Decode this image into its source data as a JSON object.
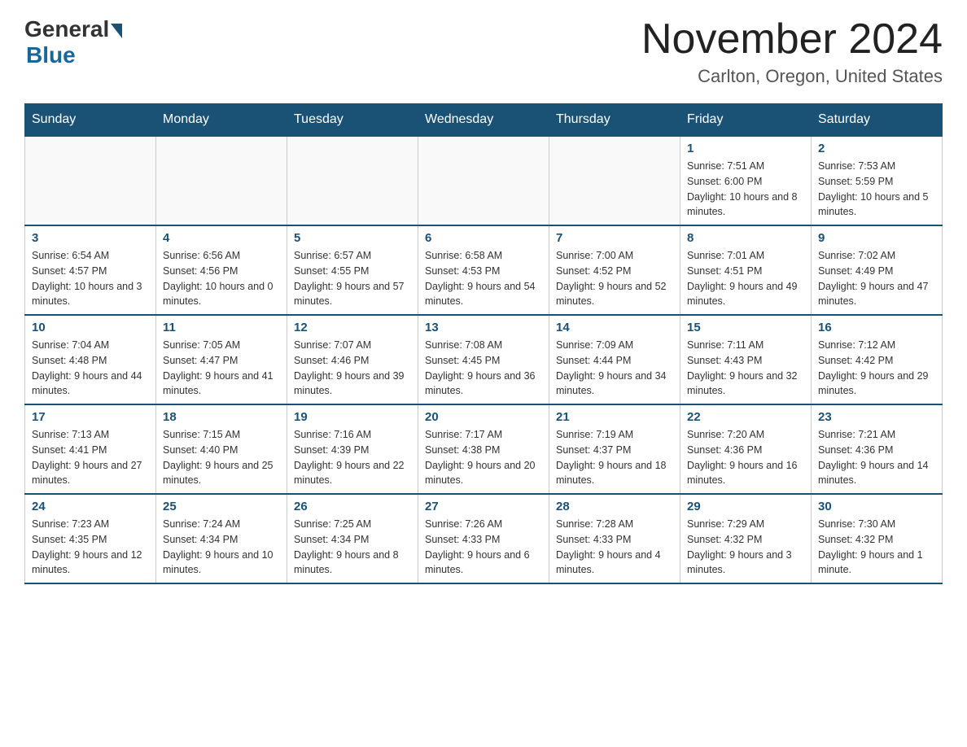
{
  "header": {
    "logo_general": "General",
    "logo_blue": "Blue",
    "month_title": "November 2024",
    "location": "Carlton, Oregon, United States"
  },
  "days_of_week": [
    "Sunday",
    "Monday",
    "Tuesday",
    "Wednesday",
    "Thursday",
    "Friday",
    "Saturday"
  ],
  "weeks": [
    [
      {
        "day": "",
        "info": ""
      },
      {
        "day": "",
        "info": ""
      },
      {
        "day": "",
        "info": ""
      },
      {
        "day": "",
        "info": ""
      },
      {
        "day": "",
        "info": ""
      },
      {
        "day": "1",
        "info": "Sunrise: 7:51 AM\nSunset: 6:00 PM\nDaylight: 10 hours and 8 minutes."
      },
      {
        "day": "2",
        "info": "Sunrise: 7:53 AM\nSunset: 5:59 PM\nDaylight: 10 hours and 5 minutes."
      }
    ],
    [
      {
        "day": "3",
        "info": "Sunrise: 6:54 AM\nSunset: 4:57 PM\nDaylight: 10 hours and 3 minutes."
      },
      {
        "day": "4",
        "info": "Sunrise: 6:56 AM\nSunset: 4:56 PM\nDaylight: 10 hours and 0 minutes."
      },
      {
        "day": "5",
        "info": "Sunrise: 6:57 AM\nSunset: 4:55 PM\nDaylight: 9 hours and 57 minutes."
      },
      {
        "day": "6",
        "info": "Sunrise: 6:58 AM\nSunset: 4:53 PM\nDaylight: 9 hours and 54 minutes."
      },
      {
        "day": "7",
        "info": "Sunrise: 7:00 AM\nSunset: 4:52 PM\nDaylight: 9 hours and 52 minutes."
      },
      {
        "day": "8",
        "info": "Sunrise: 7:01 AM\nSunset: 4:51 PM\nDaylight: 9 hours and 49 minutes."
      },
      {
        "day": "9",
        "info": "Sunrise: 7:02 AM\nSunset: 4:49 PM\nDaylight: 9 hours and 47 minutes."
      }
    ],
    [
      {
        "day": "10",
        "info": "Sunrise: 7:04 AM\nSunset: 4:48 PM\nDaylight: 9 hours and 44 minutes."
      },
      {
        "day": "11",
        "info": "Sunrise: 7:05 AM\nSunset: 4:47 PM\nDaylight: 9 hours and 41 minutes."
      },
      {
        "day": "12",
        "info": "Sunrise: 7:07 AM\nSunset: 4:46 PM\nDaylight: 9 hours and 39 minutes."
      },
      {
        "day": "13",
        "info": "Sunrise: 7:08 AM\nSunset: 4:45 PM\nDaylight: 9 hours and 36 minutes."
      },
      {
        "day": "14",
        "info": "Sunrise: 7:09 AM\nSunset: 4:44 PM\nDaylight: 9 hours and 34 minutes."
      },
      {
        "day": "15",
        "info": "Sunrise: 7:11 AM\nSunset: 4:43 PM\nDaylight: 9 hours and 32 minutes."
      },
      {
        "day": "16",
        "info": "Sunrise: 7:12 AM\nSunset: 4:42 PM\nDaylight: 9 hours and 29 minutes."
      }
    ],
    [
      {
        "day": "17",
        "info": "Sunrise: 7:13 AM\nSunset: 4:41 PM\nDaylight: 9 hours and 27 minutes."
      },
      {
        "day": "18",
        "info": "Sunrise: 7:15 AM\nSunset: 4:40 PM\nDaylight: 9 hours and 25 minutes."
      },
      {
        "day": "19",
        "info": "Sunrise: 7:16 AM\nSunset: 4:39 PM\nDaylight: 9 hours and 22 minutes."
      },
      {
        "day": "20",
        "info": "Sunrise: 7:17 AM\nSunset: 4:38 PM\nDaylight: 9 hours and 20 minutes."
      },
      {
        "day": "21",
        "info": "Sunrise: 7:19 AM\nSunset: 4:37 PM\nDaylight: 9 hours and 18 minutes."
      },
      {
        "day": "22",
        "info": "Sunrise: 7:20 AM\nSunset: 4:36 PM\nDaylight: 9 hours and 16 minutes."
      },
      {
        "day": "23",
        "info": "Sunrise: 7:21 AM\nSunset: 4:36 PM\nDaylight: 9 hours and 14 minutes."
      }
    ],
    [
      {
        "day": "24",
        "info": "Sunrise: 7:23 AM\nSunset: 4:35 PM\nDaylight: 9 hours and 12 minutes."
      },
      {
        "day": "25",
        "info": "Sunrise: 7:24 AM\nSunset: 4:34 PM\nDaylight: 9 hours and 10 minutes."
      },
      {
        "day": "26",
        "info": "Sunrise: 7:25 AM\nSunset: 4:34 PM\nDaylight: 9 hours and 8 minutes."
      },
      {
        "day": "27",
        "info": "Sunrise: 7:26 AM\nSunset: 4:33 PM\nDaylight: 9 hours and 6 minutes."
      },
      {
        "day": "28",
        "info": "Sunrise: 7:28 AM\nSunset: 4:33 PM\nDaylight: 9 hours and 4 minutes."
      },
      {
        "day": "29",
        "info": "Sunrise: 7:29 AM\nSunset: 4:32 PM\nDaylight: 9 hours and 3 minutes."
      },
      {
        "day": "30",
        "info": "Sunrise: 7:30 AM\nSunset: 4:32 PM\nDaylight: 9 hours and 1 minute."
      }
    ]
  ]
}
